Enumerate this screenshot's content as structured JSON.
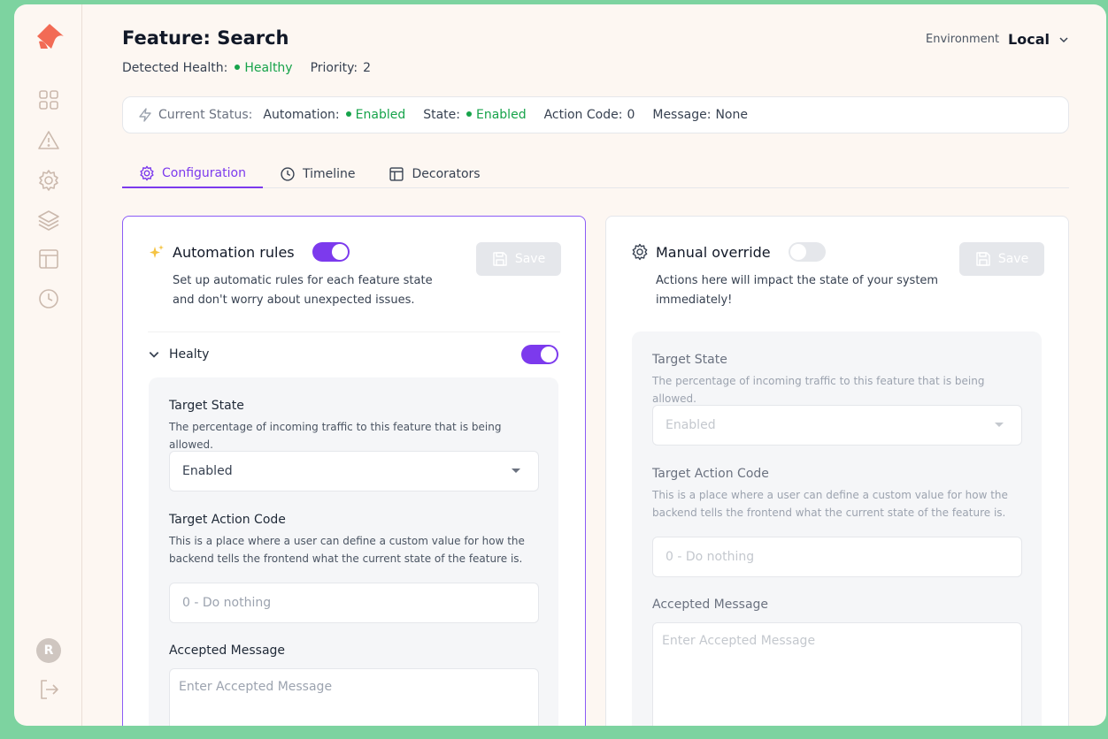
{
  "page": {
    "title": "Feature: Search",
    "health_label": "Detected Health:",
    "health_value": "Healthy",
    "priority_label": "Priority:",
    "priority_value": "2"
  },
  "environment": {
    "label": "Environment",
    "value": "Local"
  },
  "status": {
    "label": "Current Status:",
    "automation_label": "Automation:",
    "automation_value": "Enabled",
    "state_label": "State:",
    "state_value": "Enabled",
    "action_code_label": "Action Code:",
    "action_code_value": "0",
    "message_label": "Message:",
    "message_value": "None"
  },
  "tabs": [
    {
      "label": "Configuration",
      "icon": "gear-icon",
      "active": true
    },
    {
      "label": "Timeline",
      "icon": "clock-icon",
      "active": false
    },
    {
      "label": "Decorators",
      "icon": "layout-icon",
      "active": false
    }
  ],
  "automation": {
    "title": "Automation rules",
    "enabled": true,
    "description": "Set up automatic rules for each feature state and don't worry about unexpected issues.",
    "save_label": "Save",
    "section_label": "Healty",
    "section_enabled": true,
    "target_state_label": "Target State",
    "target_state_help": "The percentage of incoming traffic to this feature that is being allowed.",
    "target_state_value": "Enabled",
    "action_code_label": "Target Action Code",
    "action_code_help": "This is a place where a user can define a custom value for how the backend tells the frontend what the current state of the feature is.",
    "action_code_placeholder": "0 - Do nothing",
    "message_label": "Accepted Message",
    "message_placeholder": "Enter Accepted Message"
  },
  "manual": {
    "title": "Manual override",
    "enabled": false,
    "description": "Actions here will impact the state of your system immediately!",
    "save_label": "Save",
    "target_state_label": "Target State",
    "target_state_help": "The percentage of incoming traffic to this feature that is being allowed.",
    "target_state_value": "Enabled",
    "action_code_label": "Target Action Code",
    "action_code_help": "This is a place where a user can define a custom value for how the backend tells the frontend what the current state of the feature is.",
    "action_code_placeholder": "0 - Do nothing",
    "message_label": "Accepted Message",
    "message_placeholder": "Enter Accepted Message"
  },
  "sidebar": {
    "avatar_initial": "R",
    "icons": [
      "logo-icon",
      "dashboard-icon",
      "warning-icon",
      "gear-icon",
      "layers-icon",
      "layout-icon",
      "clock-icon",
      "logout-icon"
    ]
  },
  "colors": {
    "accent": "#7c3aed",
    "success": "#16a34a",
    "background": "#fdf7f2",
    "frame": "#7dd3a0"
  }
}
